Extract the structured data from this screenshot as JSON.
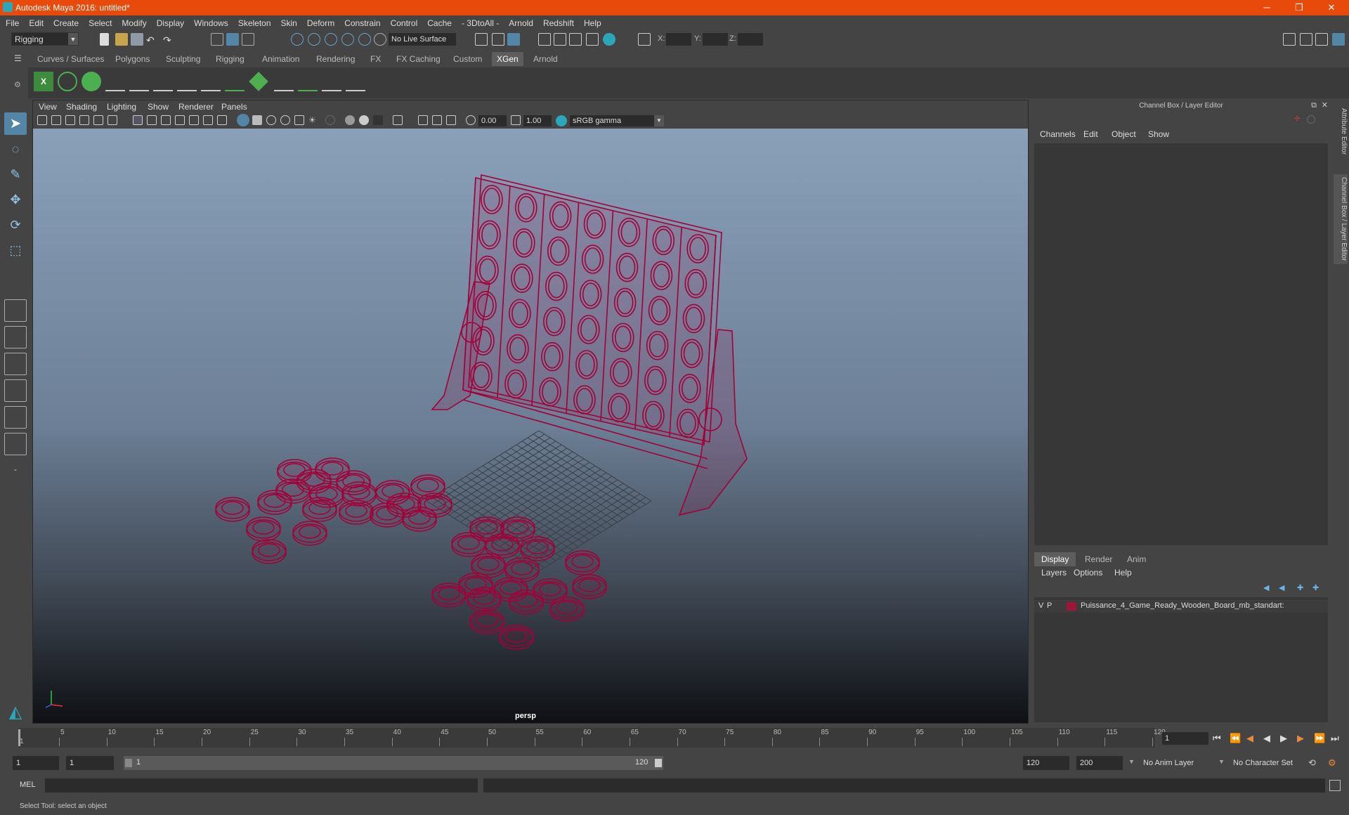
{
  "window": {
    "title": "Autodesk Maya 2016: untitled*",
    "minimize": "─",
    "maximize": "❐",
    "close": "✕"
  },
  "menubar": [
    "File",
    "Edit",
    "Create",
    "Select",
    "Modify",
    "Display",
    "Windows",
    "Skeleton",
    "Skin",
    "Deform",
    "Constrain",
    "Control",
    "Cache",
    "- 3DtoAll -",
    "Arnold",
    "Redshift",
    "Help"
  ],
  "statusline": {
    "mode": "Rigging",
    "live_surface": "No Live Surface",
    "x_label": "X:",
    "y_label": "Y:",
    "z_label": "Z:"
  },
  "shelf_tabs": [
    "Curves / Surfaces",
    "Polygons",
    "Sculpting",
    "Rigging",
    "Animation",
    "Rendering",
    "FX",
    "FX Caching",
    "Custom",
    "XGen",
    "Arnold"
  ],
  "active_shelf_tab": "XGen",
  "viewport": {
    "menus": [
      "View",
      "Shading",
      "Lighting",
      "Show",
      "Renderer",
      "Panels"
    ],
    "exposure": "0.00",
    "gamma": "1.00",
    "color_space": "sRGB gamma",
    "camera": "persp"
  },
  "channel_box": {
    "header": "Channel Box / Layer Editor",
    "menus": [
      "Channels",
      "Edit",
      "Object",
      "Show"
    ]
  },
  "layer_editor": {
    "tabs": [
      "Display",
      "Render",
      "Anim"
    ],
    "active_tab": "Display",
    "menus": [
      "Layers",
      "Options",
      "Help"
    ],
    "layer": {
      "v": "V",
      "p": "P",
      "name": "Puissance_4_Game_Ready_Wooden_Board_mb_standart:",
      "color": "#9b1638"
    }
  },
  "side_tabs": [
    "Attribute Editor",
    "Channel Box / Layer Editor"
  ],
  "timeline": {
    "ticks": [
      "5",
      "10",
      "15",
      "20",
      "25",
      "30",
      "35",
      "40",
      "45",
      "50",
      "55",
      "60",
      "65",
      "70",
      "75",
      "80",
      "85",
      "90",
      "95",
      "100",
      "105",
      "110",
      "115",
      "120"
    ],
    "start_tick": "1",
    "current_frame": "1"
  },
  "range": {
    "start": "1",
    "playback_start": "1",
    "slider_start": "1",
    "slider_end": "120",
    "playback_end": "120",
    "end": "200",
    "anim_layer": "No Anim Layer",
    "character_set": "No Character Set"
  },
  "command_line": {
    "label": "MEL"
  },
  "help_line": "Select Tool: select an object",
  "wire_color": "#a3003a"
}
